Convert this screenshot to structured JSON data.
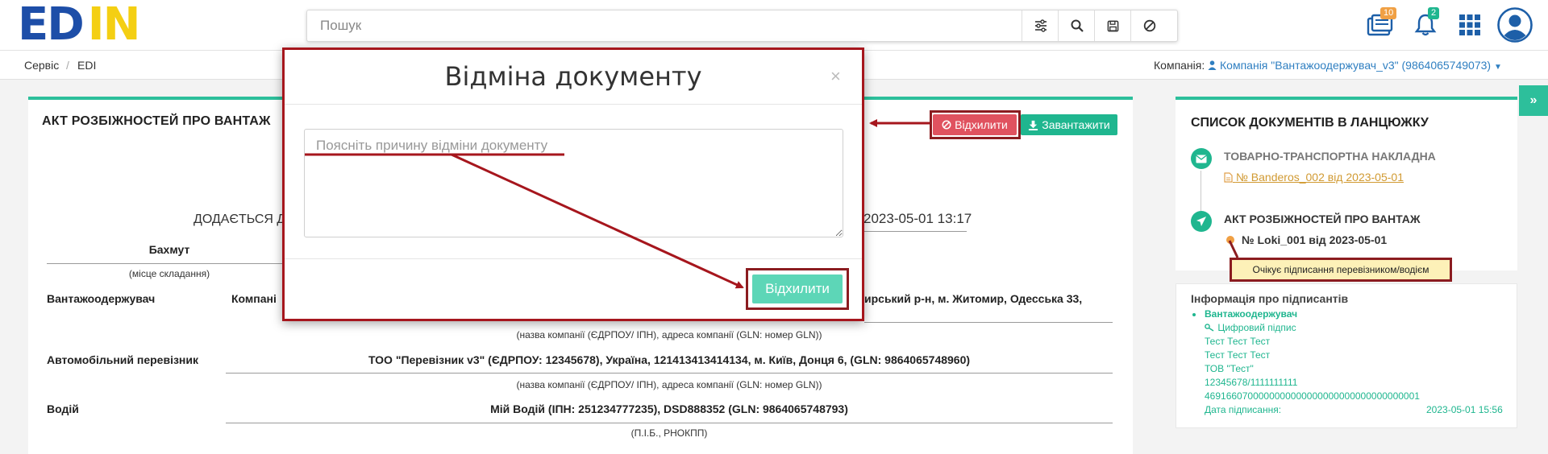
{
  "header": {
    "logo_left": "ED",
    "logo_right": "IN",
    "search_placeholder": "Пошук",
    "documents_badge": "10",
    "notifications_badge": "2"
  },
  "breadcrumb": {
    "item1": "Сервіс",
    "sep": "/",
    "item2": "EDI"
  },
  "company": {
    "label": "Компанія:",
    "value": "Компанія \"Вантажоодержувач_v3\" (9864065749073)"
  },
  "document": {
    "title": "АКТ РОЗБІЖНОСТЕЙ ПРО ВАНТАЖ",
    "reject_button": "Відхилити",
    "download_button": "Завантажити",
    "attached_label": "ДОДАЄТЬСЯ Д",
    "datetime": "2023-05-01 13:17",
    "place_value": "Бахмут",
    "place_caption": "(місце складання)",
    "consignee_label": "Вантажоодержувач",
    "consignee_value_left": "Компані",
    "consignee_value_right": "ирський р-н, м. Житомир, Одесська 33,",
    "company_caption": "(назва компанії (ЄДРПОУ/ ІПН), адреса компанії (GLN: номер GLN))",
    "carrier_label": "Автомобільний перевізник",
    "carrier_value": "ТОО \"Перевізник v3\" (ЄДРПОУ: 12345678), Україна, 121413413414134, м. Київ, Донця 6, (GLN: 9864065748960)",
    "carrier_caption": "(назва компанії (ЄДРПОУ/ ІПН), адреса компанії (GLN: номер GLN))",
    "driver_label": "Водій",
    "driver_value": "Мій Водій (ІПН: 251234777235), DSD888352 (GLN: 9864065748793)",
    "driver_caption": "(П.І.Б., РНОКПП)"
  },
  "chain": {
    "title": "СПИСОК ДОКУМЕНТІВ В ЛАНЦЮЖКУ",
    "item1_type": "ТОВАРНО-ТРАНСПОРТНА НАКЛАДНА",
    "item1_link": " № Banderos_002 від 2023-05-01",
    "item2_type": "АКТ РОЗБІЖНОСТЕЙ ПРО ВАНТАЖ",
    "item2_number": "№ Loki_001 від 2023-05-01",
    "item2_status": "Очікує підписання перевізником/водієм"
  },
  "signers": {
    "title": "Інформація про підписантів",
    "role": "Вантажоодержувач",
    "signature_type": "Цифровий підпис",
    "line1": "Тест Тест Тест",
    "line2": "Тест Тест Тест",
    "line3": "ТОВ \"Тест\"",
    "line4": "12345678/1111111111",
    "line5": "4691660700000000000000000000000000000001",
    "date_label": "Дата підписання:",
    "date_value": "2023-05-01 15:56"
  },
  "modal": {
    "title": "Відміна документу",
    "close": "×",
    "reason_placeholder": "Поясніть причину відміни документу",
    "submit": "Відхилити"
  },
  "colors": {
    "accent_green": "#2dbf9b",
    "reject_red": "#e0525f",
    "annotation_red": "#a6161d",
    "brand_blue": "#1d4ea8",
    "brand_yellow": "#f4cf13"
  }
}
